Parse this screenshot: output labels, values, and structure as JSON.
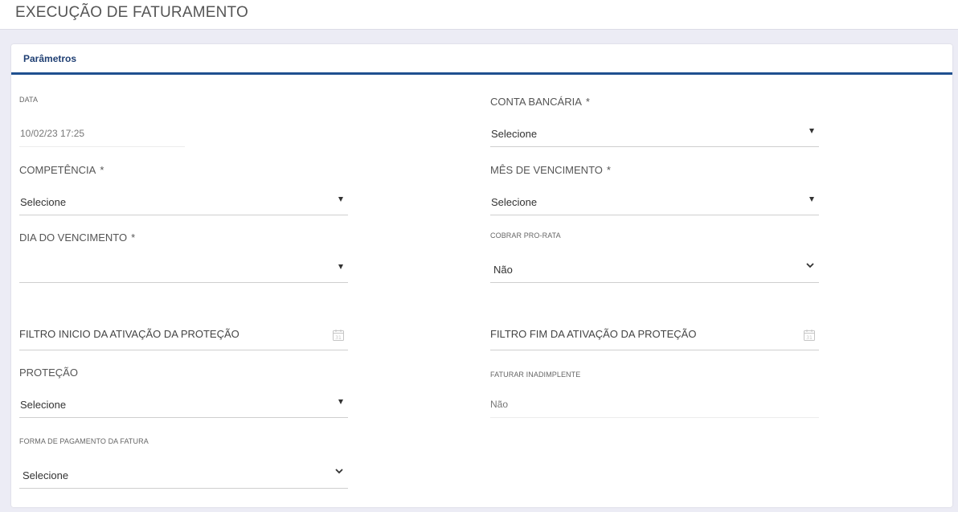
{
  "header": {
    "title": "EXECUÇÃO DE FATURAMENTO"
  },
  "panel": {
    "title": "Parâmetros"
  },
  "form": {
    "data": {
      "label": "DATA",
      "value": "10/02/23 17:25"
    },
    "conta_bancaria": {
      "label": "CONTA BANCÁRIA",
      "required": "*",
      "value": "Selecione"
    },
    "competencia": {
      "label": "COMPETÊNCIA",
      "required": "*",
      "value": "Selecione"
    },
    "mes_vencimento": {
      "label": "MÊS DE VENCIMENTO",
      "required": "*",
      "value": "Selecione"
    },
    "dia_vencimento": {
      "label": "DIA DO VENCIMENTO",
      "required": "*",
      "value": ""
    },
    "cobrar_pro_rata": {
      "label": "COBRAR PRO-RATA",
      "value": "Não"
    },
    "filtro_inicio": {
      "label": "FILTRO INICIO DA ATIVAÇÃO DA PROTEÇÃO",
      "calendar_day": "31"
    },
    "filtro_fim": {
      "label": "FILTRO FIM DA ATIVAÇÃO DA PROTEÇÃO",
      "calendar_day": "31"
    },
    "protecao": {
      "label": "PROTEÇÃO",
      "value": "Selecione"
    },
    "faturar_inadimplente": {
      "label": "FATURAR INADIMPLENTE",
      "value": "Não"
    },
    "forma_pagamento": {
      "label": "FORMA DE PAGAMENTO DA FATURA",
      "value": "Selecione"
    }
  },
  "icons": {
    "select_caret": "caret-down-icon",
    "select_chevron": "chevron-down-icon",
    "date_picker": "calendar-icon"
  },
  "colors": {
    "accent": "#1f4f8f",
    "panel_title": "#1f3f73",
    "background": "#ececf5"
  }
}
